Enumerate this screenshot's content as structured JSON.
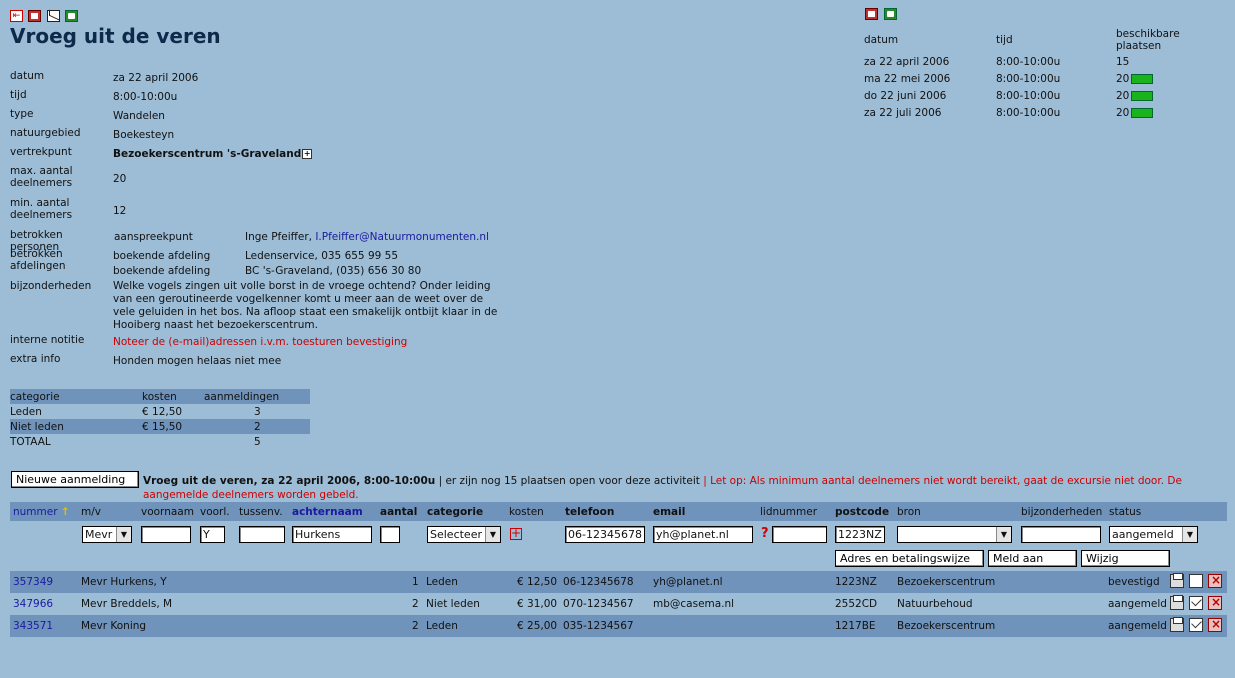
{
  "title": "Vroeg uit de veren",
  "details": {
    "datum_label": "datum",
    "datum": "za 22 april 2006",
    "tijd_label": "tijd",
    "tijd": "8:00-10:00u",
    "type_label": "type",
    "type": "Wandelen",
    "gebied_label": "natuurgebied",
    "gebied": "Boekesteyn",
    "vertrek_label": "vertrekpunt",
    "vertrek": "Bezoekerscentrum 's-Graveland",
    "max_label": "max. aantal deelnemers",
    "max": "20",
    "min_label": "min. aantal deelnemers",
    "min": "12",
    "personen_label": "betrokken personen",
    "personen_role": "aanspreekpunt",
    "personen_name": "Inge Pfeiffer, ",
    "personen_email": "I.Pfeiffer@Natuurmonumenten.nl",
    "afdelingen_label": "betrokken afdelingen",
    "afd1_role": "boekende afdeling",
    "afd1_value": "Ledenservice, 035 655 99 55",
    "afd2_role": "boekende afdeling",
    "afd2_value": "BC 's-Graveland, (035) 656 30 80",
    "bijz_label": "bijzonderheden",
    "bijz": "Welke vogels zingen uit volle borst in de vroege ochtend? Onder leiding van een geroutineerde vogelkenner komt u meer aan de weet over de vele geluiden in het bos. Na afloop staat een smakelijk ontbijt klaar in de Hooiberg naast het bezoekerscentrum.",
    "notitie_label": "interne notitie",
    "notitie": "Noteer de (e-mail)adressen i.v.m. toesturen bevestiging",
    "extra_label": "extra info",
    "extra": "Honden mogen helaas niet mee"
  },
  "categories": {
    "headers": [
      "categorie",
      "kosten",
      "aanmeldingen"
    ],
    "rows": [
      {
        "categorie": "Leden",
        "kosten": "€ 12,50",
        "aanmeldingen": "3"
      },
      {
        "categorie": "Niet leden",
        "kosten": "€ 15,50",
        "aanmeldingen": "2"
      },
      {
        "categorie": "TOTAAL",
        "kosten": "",
        "aanmeldingen": "5"
      }
    ]
  },
  "dates": {
    "headers": [
      "datum",
      "tijd",
      "beschikbare plaatsen"
    ],
    "rows": [
      {
        "datum": "za 22 april 2006",
        "tijd": "8:00-10:00u",
        "plaatsen": "15",
        "flag": false
      },
      {
        "datum": "ma 22 mei 2006",
        "tijd": "8:00-10:00u",
        "plaatsen": "20",
        "flag": true
      },
      {
        "datum": "do 22 juni 2006",
        "tijd": "8:00-10:00u",
        "plaatsen": "20",
        "flag": true
      },
      {
        "datum": "za 22 juli 2006",
        "tijd": "8:00-10:00u",
        "plaatsen": "20",
        "flag": true
      }
    ]
  },
  "registration": {
    "new_button": "Nieuwe aanmelding",
    "info_bold": "Vroeg uit de veren, za 22 april 2006, 8:00-10:00u",
    "info_text": " | er zijn nog 15 plaatsen open voor deze activiteit ",
    "warning": "| Let op: Als minimum aantal deelnemers niet wordt bereikt, gaat de excursie niet door. De aangemelde deelnemers worden gebeld."
  },
  "columns": {
    "nummer": "nummer",
    "mv": "m/v",
    "voornaam": "voornaam",
    "voorl": "voorl.",
    "tussenv": "tussenv.",
    "achternaam": "achternaam",
    "aantal": "aantal",
    "categorie": "categorie",
    "kosten": "kosten",
    "telefoon": "telefoon",
    "email": "email",
    "lidnummer": "lidnummer",
    "postcode": "postcode",
    "bron": "bron",
    "bijzonderheden": "bijzonderheden",
    "status": "status"
  },
  "form": {
    "mv": "Mevr",
    "voornaam": "",
    "voorl": "Y",
    "tussenv": "",
    "achternaam": "Hurkens",
    "aantal": "",
    "categorie": "Selecteer",
    "telefoon": "06-12345678",
    "email": "yh@planet.nl",
    "lidnummer": "",
    "postcode": "1223NZ",
    "bron": "",
    "bijzonderheden": "",
    "status": "aangemeld",
    "btn_adres": "Adres en betalingswijze",
    "btn_meld": "Meld aan",
    "btn_wijzig": "Wijzig"
  },
  "participants": [
    {
      "nummer": "357349",
      "naam": "Mevr Hurkens, Y",
      "aantal": "1",
      "categorie": "Leden",
      "kosten": "€ 12,50",
      "telefoon": "06-12345678",
      "email": "yh@planet.nl",
      "postcode": "1223NZ",
      "bron": "Bezoekerscentrum",
      "status": "bevestigd",
      "dark": true
    },
    {
      "nummer": "347966",
      "naam": "Mevr Breddels, M",
      "aantal": "2",
      "categorie": "Niet leden",
      "kosten": "€ 31,00",
      "telefoon": "070-1234567",
      "email": "mb@casema.nl",
      "postcode": "2552CD",
      "bron": "Natuurbehoud",
      "status": "aangemeld",
      "dark": false
    },
    {
      "nummer": "343571",
      "naam": "Mevr Koning",
      "aantal": "2",
      "categorie": "Leden",
      "kosten": "€ 25,00",
      "telefoon": "035-1234567",
      "email": "",
      "postcode": "1217BE",
      "bron": "Bezoekerscentrum",
      "status": "aangemeld",
      "dark": true
    }
  ]
}
